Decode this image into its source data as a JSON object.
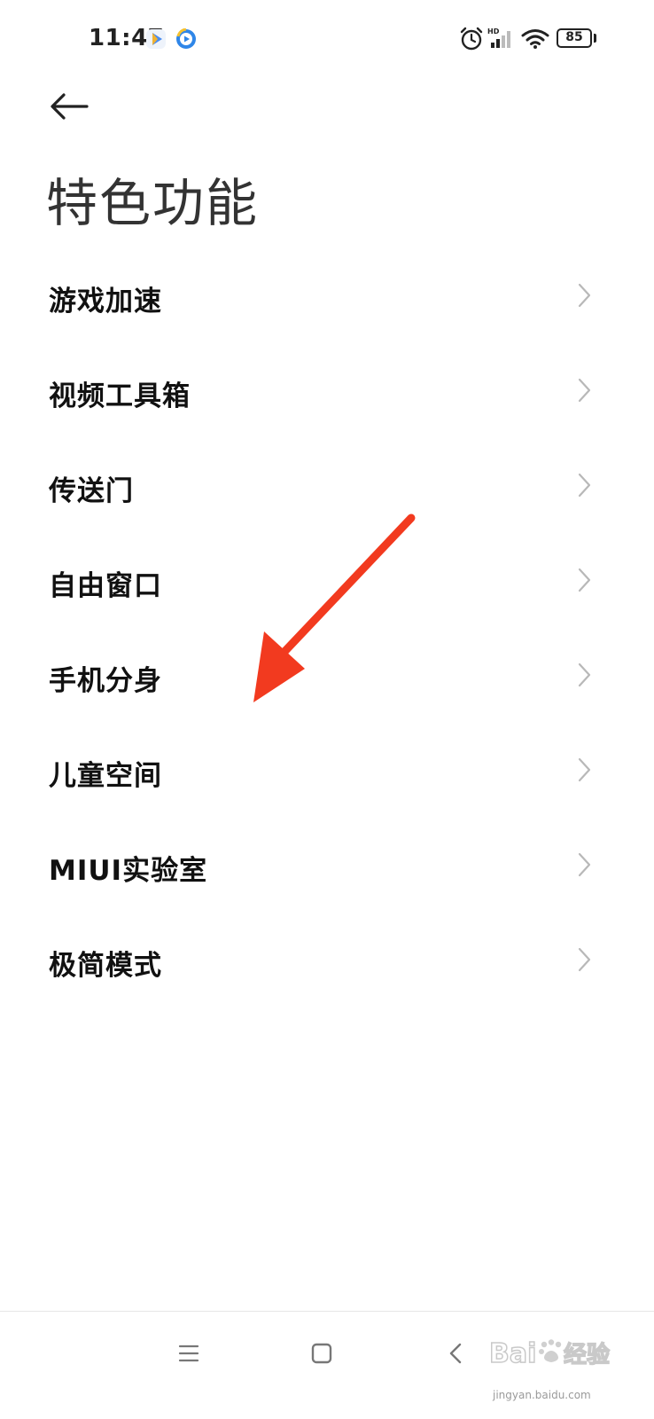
{
  "status_bar": {
    "time": "11:47",
    "battery": "85",
    "icons": [
      "video-app-icon",
      "browser-app-icon",
      "alarm-icon",
      "hd-signal-icon",
      "wifi-icon",
      "battery-icon"
    ]
  },
  "header": {
    "back_icon": "arrow-left-icon",
    "title": "特色功能"
  },
  "menu": {
    "items": [
      {
        "label": "游戏加速"
      },
      {
        "label": "视频工具箱"
      },
      {
        "label": "传送门"
      },
      {
        "label": "自由窗口"
      },
      {
        "label": "手机分身"
      },
      {
        "label": "儿童空间"
      },
      {
        "label": "MIUI实验室"
      },
      {
        "label": "极简模式"
      }
    ],
    "chevron_icon": "chevron-right-icon"
  },
  "annotation": {
    "arrow_color": "#f23a1f"
  },
  "nav_bar": {
    "icons": [
      "menu-icon",
      "home-icon",
      "back-icon"
    ]
  },
  "watermark": {
    "text": "jingyan.baidu.com"
  },
  "colors": {
    "text_primary": "#111111",
    "chevron": "#b8b8b8",
    "background": "#ffffff"
  }
}
